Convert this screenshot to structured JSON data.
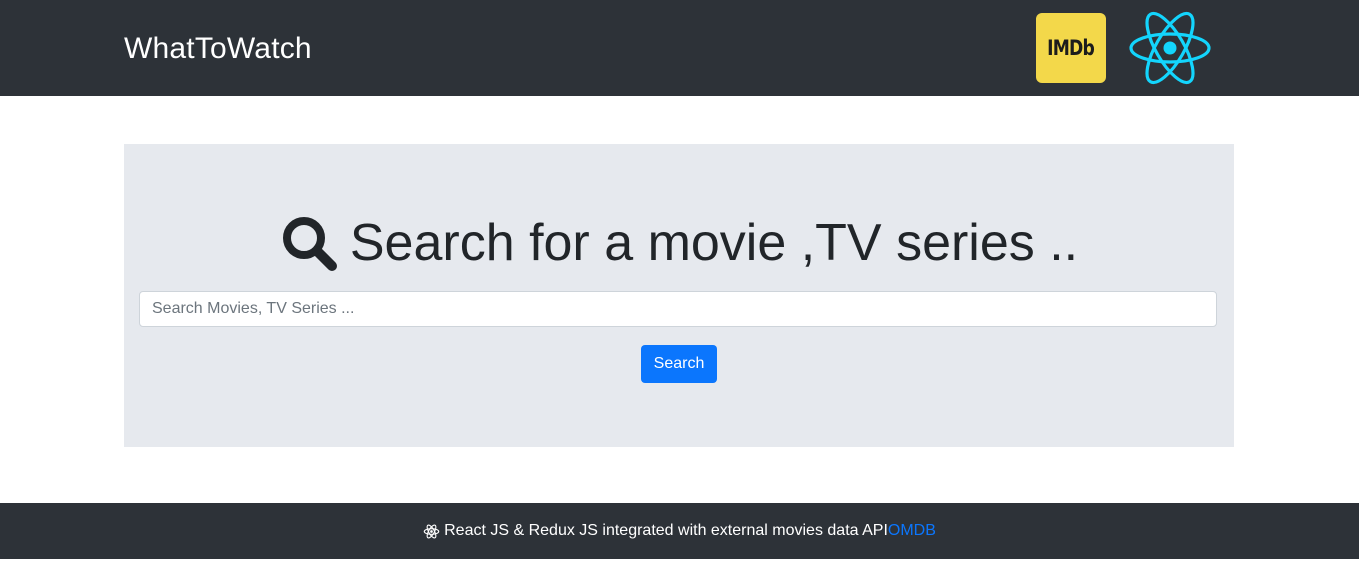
{
  "navbar": {
    "brand": "WhatToWatch",
    "imdb_logo_text": "IMDb",
    "imdb_logo_color": "#f3d84a",
    "react_logo_icon": "react-logo-icon",
    "react_logo_color": "#13d5fd",
    "background": "#2d3238"
  },
  "hero": {
    "icon": "search-icon",
    "title": "Search for a movie ,TV series ..",
    "search_placeholder": "Search Movies, TV Series ...",
    "search_value": "",
    "search_button_label": "Search",
    "background": "#e6e9ee",
    "button_color": "#0b76fd"
  },
  "footer": {
    "icon": "react-atom-icon",
    "text": "React JS & Redux JS integrated with external movies data API",
    "link_label": "OMDB",
    "link_color": "#0b76fd"
  }
}
